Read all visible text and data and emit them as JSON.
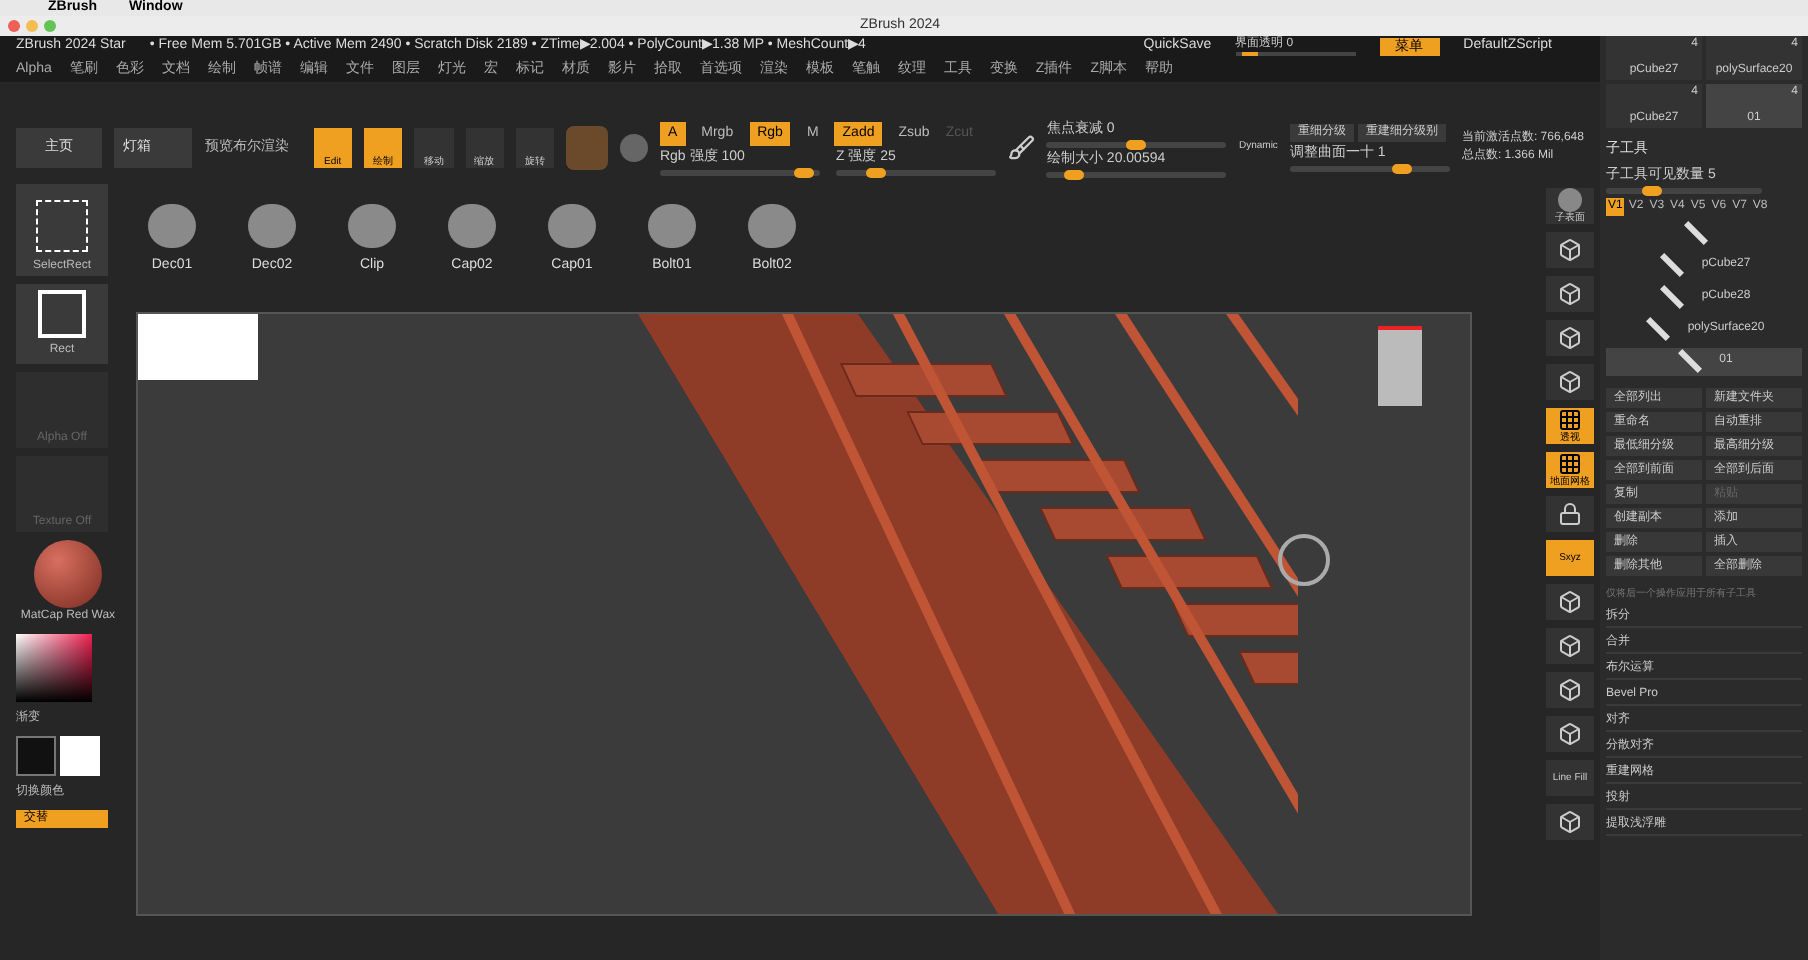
{
  "os_menu": [
    "ZBrush",
    "Window"
  ],
  "window": {
    "title": "ZBrush 2024"
  },
  "status_bar": {
    "items": [
      "ZBrush 2024 Star",
      "• Free Mem 5.701GB • Active Mem 2490 • Scratch Disk 2189 • ZTime▶2.004 • PolyCount▶1.38 MP • MeshCount▶4"
    ],
    "quicksave": "QuickSave",
    "transparency": {
      "label": "界面透明 0",
      "level": 0.05
    },
    "menu_button": "菜单",
    "script": "DefaultZScript"
  },
  "menu": [
    "Alpha",
    "笔刷",
    "色彩",
    "文档",
    "绘制",
    "帧谱",
    "编辑",
    "文件",
    "图层",
    "灯光",
    "宏",
    "标记",
    "材质",
    "影片",
    "拾取",
    "首选项",
    "渲染",
    "模板",
    "笔触",
    "纹理",
    "工具",
    "变换",
    "Z插件",
    "Z脚本",
    "帮助"
  ],
  "toolbar": {
    "home": "主页",
    "lightbox": "灯箱",
    "preview": "预览布尔渲染",
    "modes": [
      {
        "label": "Edit",
        "selected": true
      },
      {
        "label": "绘制",
        "selected": true
      },
      {
        "label": "移动",
        "selected": false
      },
      {
        "label": "缩放",
        "selected": false
      },
      {
        "label": "旋转",
        "selected": false
      }
    ],
    "channels": [
      {
        "label": "A",
        "selected": true
      },
      {
        "label": "Mrgb",
        "selected": false
      },
      {
        "label": "Rgb",
        "selected": true
      },
      {
        "label": "M",
        "selected": false
      }
    ],
    "z_modes": [
      {
        "label": "Zadd",
        "selected": true
      },
      {
        "label": "Zsub",
        "selected": false
      }
    ],
    "zcut": "Zcut",
    "intensity_sliders": [
      {
        "label": "Rgb 强度 100",
        "level": 0.9
      },
      {
        "label": "Z 强度 25",
        "level": 0.25
      }
    ],
    "draw_sliders": [
      {
        "label": "焦点衰减 0",
        "level": 0.5
      },
      {
        "label": "绘制大小 20.00594",
        "level": 0.15
      }
    ],
    "dynamic": "Dynamic",
    "subdiv_buttons": [
      "重细分级",
      "重建细分级别"
    ],
    "subdiv_slider": {
      "label": "调整曲面一十 1",
      "level": 0.7
    },
    "stats": [
      "当前激活点数: 766,648",
      "总点数: 1.366 Mil"
    ]
  },
  "brushes": {
    "current": "SelectRect",
    "items": [
      "Dec01",
      "Dec02",
      "Clip",
      "Cap02",
      "Cap01",
      "Bolt01",
      "Bolt02"
    ]
  },
  "left_column": {
    "stroke": "Rect",
    "alpha": "Alpha Off",
    "texture": "Texture Off",
    "material": "MatCap Red Wax",
    "gradient": "渐变",
    "switch_color": "切换颜色",
    "alternate": "交替"
  },
  "shelf": [
    {
      "kind": "sphere",
      "label": "子表面",
      "selected": false
    },
    {
      "kind": "tool",
      "selected": false
    },
    {
      "kind": "tool",
      "selected": false
    },
    {
      "kind": "tool",
      "selected": false
    },
    {
      "kind": "tool",
      "selected": false
    },
    {
      "kind": "grid",
      "label": "透视",
      "selected": true
    },
    {
      "kind": "grid",
      "label": "地面网格",
      "selected": true
    },
    {
      "kind": "lock",
      "selected": false
    },
    {
      "kind": "text",
      "label": "Sxyz",
      "selected": true
    },
    {
      "kind": "tool",
      "selected": false
    },
    {
      "kind": "tool",
      "selected": false
    },
    {
      "kind": "tool",
      "selected": false
    },
    {
      "kind": "tool",
      "selected": false
    },
    {
      "kind": "text",
      "label": "Line Fill",
      "selected": false
    },
    {
      "kind": "tool",
      "selected": false
    }
  ],
  "tool_thumbs": [
    {
      "label": "pCube27",
      "count": "4",
      "selected": false
    },
    {
      "label": "polySurface20",
      "count": "4",
      "selected": false
    },
    {
      "label": "pCube27",
      "count": "4",
      "selected": false
    },
    {
      "label": "01",
      "count": "4",
      "selected": true
    }
  ],
  "subtool": {
    "title": "子工具",
    "visible_count": {
      "label": "子工具可见数量 5",
      "level": 0.3
    },
    "versions": [
      {
        "label": "V1",
        "selected": true
      },
      {
        "label": "V2",
        "selected": false
      },
      {
        "label": "V3",
        "selected": false
      },
      {
        "label": "V4",
        "selected": false
      },
      {
        "label": "V5",
        "selected": false
      },
      {
        "label": "V6",
        "selected": false
      },
      {
        "label": "V7",
        "selected": false
      },
      {
        "label": "V8",
        "selected": false
      }
    ],
    "items": [
      {
        "selected": false
      },
      {
        "name": "pCube27",
        "selected": false
      },
      {
        "name": "pCube28",
        "selected": false
      },
      {
        "name": "polySurface20",
        "selected": false
      },
      {
        "name": "01",
        "selected": true
      }
    ],
    "buttons": [
      {
        "label": "全部列出",
        "disabled": false
      },
      {
        "label": "新建文件夹",
        "disabled": false
      },
      {
        "label": "重命名",
        "disabled": false
      },
      {
        "label": "自动重排",
        "disabled": false
      },
      {
        "label": "最低细分级",
        "disabled": false
      },
      {
        "label": "最高细分级",
        "disabled": false
      },
      {
        "label": "全部到前面",
        "disabled": false
      },
      {
        "label": "全部到后面",
        "disabled": false
      },
      {
        "label": "复制",
        "disabled": false
      },
      {
        "label": "粘贴",
        "disabled": true
      },
      {
        "label": "创建副本",
        "disabled": false
      },
      {
        "label": "添加",
        "disabled": false
      },
      {
        "label": "删除",
        "disabled": false
      },
      {
        "label": "插入",
        "disabled": false
      }
    ],
    "delete_buttons": [
      "删除其他",
      "全部删除"
    ],
    "note": "仅将后一个操作应用于所有子工具",
    "sections": [
      "拆分",
      "合并",
      "布尔运算",
      "Bevel Pro",
      "对齐",
      "分散对齐",
      "重建网格",
      "投射",
      "提取浅浮雕"
    ]
  }
}
